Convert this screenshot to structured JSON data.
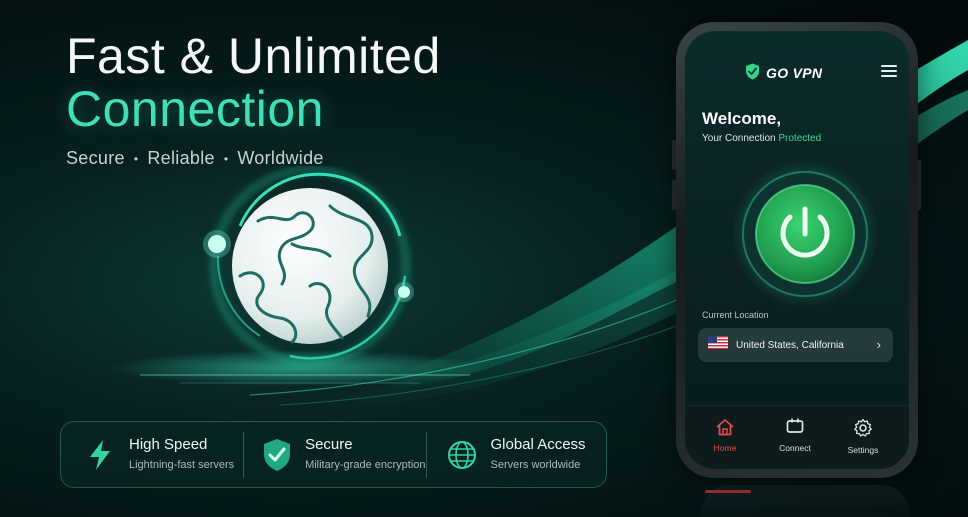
{
  "hero": {
    "line1": "Fast & Unlimited",
    "line2": "Connection",
    "tagline": [
      "Secure",
      "Reliable",
      "Worldwide"
    ]
  },
  "features": [
    {
      "icon": "lightning-icon",
      "title": "High Speed",
      "subtitle": "Lightning-fast servers"
    },
    {
      "icon": "shield-check-icon",
      "title": "Secure",
      "subtitle": "Military-grade encryption"
    },
    {
      "icon": "globe-icon",
      "title": "Global Access",
      "subtitle": "Servers worldwide"
    }
  ],
  "app": {
    "brand": "GO VPN",
    "welcome": "Welcome,",
    "status_prefix": "Your Connection",
    "status_value": "Protected",
    "location_label": "Current Location",
    "location_value": "United States, California",
    "tabs": [
      {
        "icon": "home-icon",
        "label": "Home",
        "active": true
      },
      {
        "icon": "connect-icon",
        "label": "Connect",
        "active": false
      },
      {
        "icon": "gear-icon",
        "label": "Settings",
        "active": false
      }
    ]
  },
  "colors": {
    "accent": "#3fe0b9",
    "protected": "#3fd98a",
    "power_green": "#2fb45e",
    "active_tab": "#e14a4a",
    "background": "#041314"
  }
}
